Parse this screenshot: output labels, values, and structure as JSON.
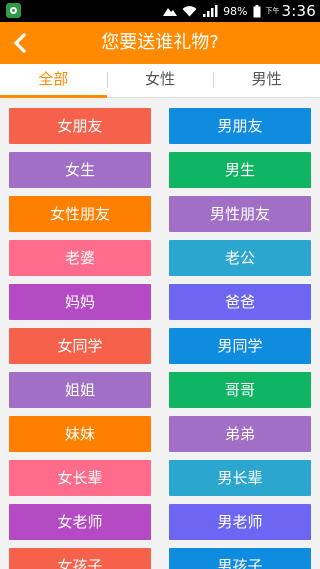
{
  "status_bar": {
    "battery": "98%",
    "ampm": "下午",
    "time": "3:36"
  },
  "header": {
    "back_icon": "chevron-left-icon",
    "title": "您要送谁礼物?"
  },
  "tabs": [
    {
      "label": "全部",
      "active": true
    },
    {
      "label": "女性",
      "active": false
    },
    {
      "label": "男性",
      "active": false
    }
  ],
  "colors": {
    "header": "#ff8a00",
    "accent": "#ff8a00"
  },
  "grid": [
    [
      {
        "label": "女朋友",
        "color": "#f5614a"
      },
      {
        "label": "男朋友",
        "color": "#0f8be0"
      }
    ],
    [
      {
        "label": "女生",
        "color": "#a26fc6"
      },
      {
        "label": "男生",
        "color": "#10b563"
      }
    ],
    [
      {
        "label": "女性朋友",
        "color": "#ff7f00"
      },
      {
        "label": "男性朋友",
        "color": "#a26fc6"
      }
    ],
    [
      {
        "label": "老婆",
        "color": "#ff6c8b"
      },
      {
        "label": "老公",
        "color": "#2ba6cf"
      }
    ],
    [
      {
        "label": "妈妈",
        "color": "#b54ac5"
      },
      {
        "label": "爸爸",
        "color": "#6d66f2"
      }
    ],
    [
      {
        "label": "女同学",
        "color": "#f5614a"
      },
      {
        "label": "男同学",
        "color": "#0f8be0"
      }
    ],
    [
      {
        "label": "姐姐",
        "color": "#a26fc6"
      },
      {
        "label": "哥哥",
        "color": "#10b563"
      }
    ],
    [
      {
        "label": "妹妹",
        "color": "#ff7f00"
      },
      {
        "label": "弟弟",
        "color": "#a26fc6"
      }
    ],
    [
      {
        "label": "女长辈",
        "color": "#ff6c8b"
      },
      {
        "label": "男长辈",
        "color": "#2ba6cf"
      }
    ],
    [
      {
        "label": "女老师",
        "color": "#b54ac5"
      },
      {
        "label": "男老师",
        "color": "#6d66f2"
      }
    ],
    [
      {
        "label": "女孩子",
        "color": "#f5614a"
      },
      {
        "label": "男孩子",
        "color": "#0f8be0"
      }
    ]
  ]
}
